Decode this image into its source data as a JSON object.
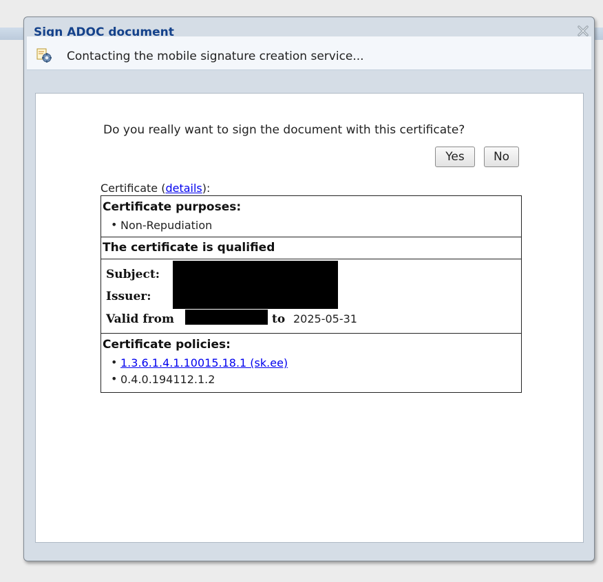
{
  "dialog": {
    "title": "Sign ADOC document",
    "status": "Contacting the mobile signature creation service...",
    "question": "Do you really want to sign the document with this certificate?",
    "yes_label": "Yes",
    "no_label": "No"
  },
  "certificate": {
    "label_prefix": "Certificate (",
    "details_link": "details",
    "label_suffix": "):",
    "purposes_heading": "Certificate purposes:",
    "purposes": [
      "Non-Repudiation"
    ],
    "qualified_text": "The certificate is qualified",
    "subject_label": "Subject:",
    "issuer_label": "Issuer:",
    "valid_from_label": "Valid from",
    "to_label": "to",
    "valid_to": "2025-05-31",
    "policies_heading": "Certificate policies:",
    "policies": [
      "1.3.6.1.4.1.10015.18.1 (sk.ee)",
      "0.4.0.194112.1.2"
    ]
  },
  "colors": {
    "title": "#15428b",
    "link": "#0000ee",
    "window_frame": "#d5dde6"
  },
  "icons": {
    "close": "close-x-icon",
    "status": "gear-certificate-icon"
  }
}
